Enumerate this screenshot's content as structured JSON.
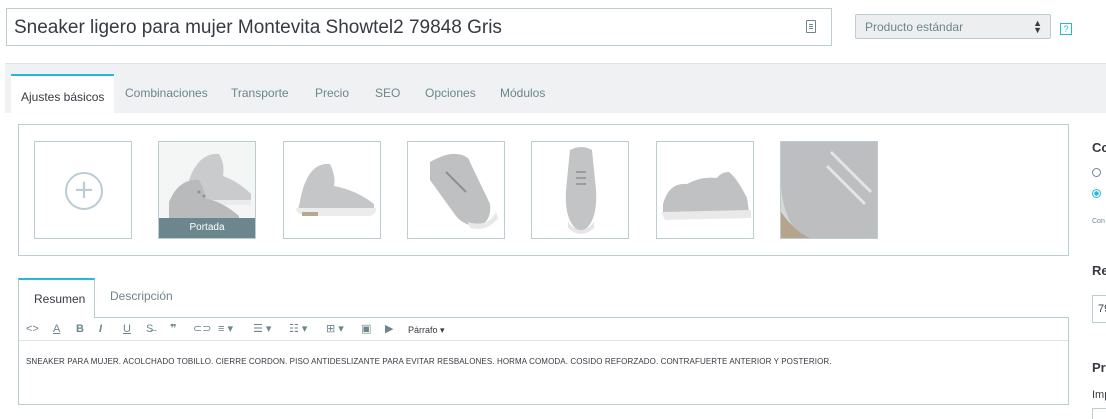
{
  "product": {
    "name": "Sneaker ligero para mujer  Montevita Showtel2 79848 Gris",
    "type_select": "Producto estándar",
    "help_label": "?"
  },
  "tabs": [
    {
      "label": "Ajustes básicos",
      "active": true
    },
    {
      "label": "Combinaciones"
    },
    {
      "label": "Transporte"
    },
    {
      "label": "Precio"
    },
    {
      "label": "SEO"
    },
    {
      "label": "Opciones"
    },
    {
      "label": "Módulos"
    }
  ],
  "images": {
    "add_symbol": "+",
    "cover_label": "Portada",
    "count": 6
  },
  "editor": {
    "tabs": [
      {
        "label": "Resumen",
        "active": true
      },
      {
        "label": "Descripción"
      }
    ],
    "toolbar": {
      "code": "<>",
      "bold": "B",
      "italic": "I",
      "underline": "U",
      "paragraph": "Párrafo"
    },
    "content": "SNEAKER PARA MUJER. ACOLCHADO TOBILLO. CIERRE CORDON. PISO ANTIDESLIZANTE PARA EVITAR RESBALONES. HORMA COMODA. COSIDO REFORZADO. CONTRAFUERTE ANTERIOR Y POSTERIOR."
  },
  "right_panel": {
    "heading1": "Co",
    "heading2": "Re",
    "field_value": "79",
    "heading3": "Pr",
    "sub_label": "Imp",
    "small_label": "Con"
  },
  "colors": {
    "accent": "#25b9d7",
    "border": "#bbcdd2",
    "muted": "#6c868e",
    "tabs_bg": "#eff1f2"
  }
}
